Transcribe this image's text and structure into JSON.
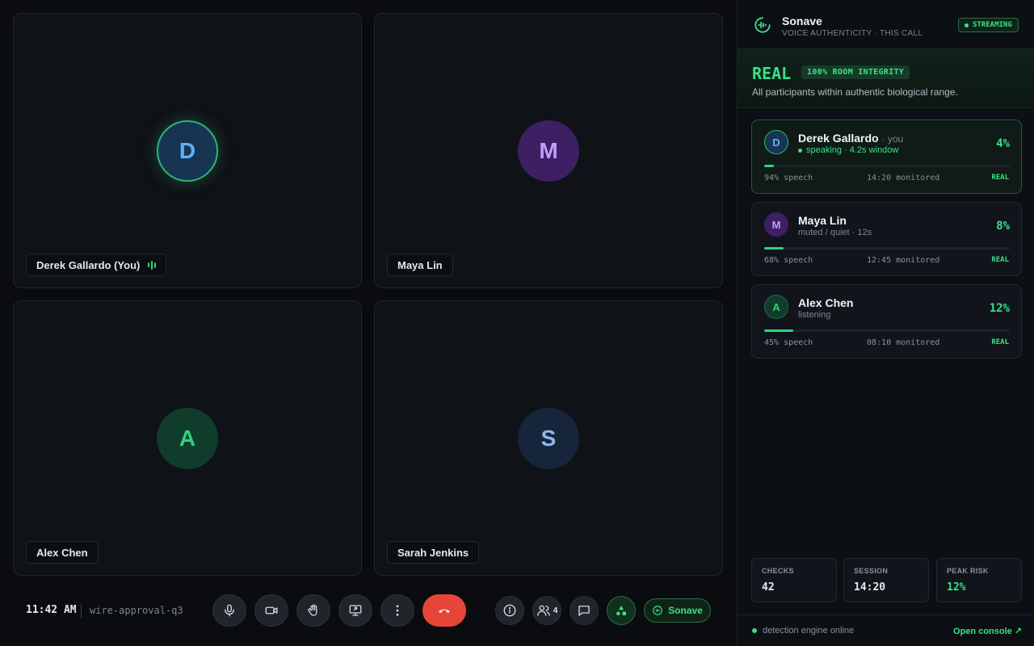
{
  "tiles": [
    {
      "initial": "D",
      "name": "Derek Gallardo (You)",
      "speaking": true
    },
    {
      "initial": "M",
      "name": "Maya Lin",
      "speaking": false
    },
    {
      "initial": "A",
      "name": "Alex Chen",
      "speaking": false
    },
    {
      "initial": "S",
      "name": "Sarah Jenkins",
      "speaking": false
    }
  ],
  "controls": {
    "time": "11:42 AM",
    "meeting_id": "wire-approval-q3",
    "people_count": "4",
    "sonave_label": "Sonave",
    "icons": [
      "microphone-icon",
      "camera-icon",
      "raise-hand-icon",
      "share-screen-icon",
      "more-icon",
      "end-call-icon",
      "info-icon",
      "people-icon",
      "chat-icon",
      "apps-icon",
      "sonave-icon"
    ]
  },
  "panel": {
    "title": "Sonave",
    "subtitle": "VOICE AUTHENTICITY · THIS CALL",
    "streaming_badge": "STREAMING",
    "verdict": {
      "label": "REAL",
      "chip": "100% ROOM INTEGRITY",
      "description": "All participants within authentic biological range."
    },
    "participants": [
      {
        "initial": "D",
        "name": "Derek Gallardo",
        "you_tag": "· you",
        "status": "speaking · 4.2s window",
        "risk": "4%",
        "risk_fraction": 0.04,
        "speech": "94% speech",
        "monitored": "14:20 monitored",
        "verdict": "REAL"
      },
      {
        "initial": "M",
        "name": "Maya Lin",
        "you_tag": "",
        "status": "muted / quiet · 12s",
        "risk": "8%",
        "risk_fraction": 0.08,
        "speech": "68% speech",
        "monitored": "12:45 monitored",
        "verdict": "REAL"
      },
      {
        "initial": "A",
        "name": "Alex Chen",
        "you_tag": "",
        "status": "listening",
        "risk": "12%",
        "risk_fraction": 0.12,
        "speech": "45% speech",
        "monitored": "08:10 monitored",
        "verdict": "REAL"
      }
    ],
    "stats": [
      {
        "label": "CHECKS",
        "value": "42"
      },
      {
        "label": "SESSION",
        "value": "14:20"
      },
      {
        "label": "PEAK RISK",
        "value": "12%"
      }
    ],
    "footer": {
      "status": "detection engine online",
      "link": "Open console",
      "link_icon": "↗"
    }
  },
  "colors": {
    "accent": "#36e08a",
    "end_call": "#e8453a",
    "background": "#0a0c0f",
    "panel_bg": "#0c0f13"
  }
}
